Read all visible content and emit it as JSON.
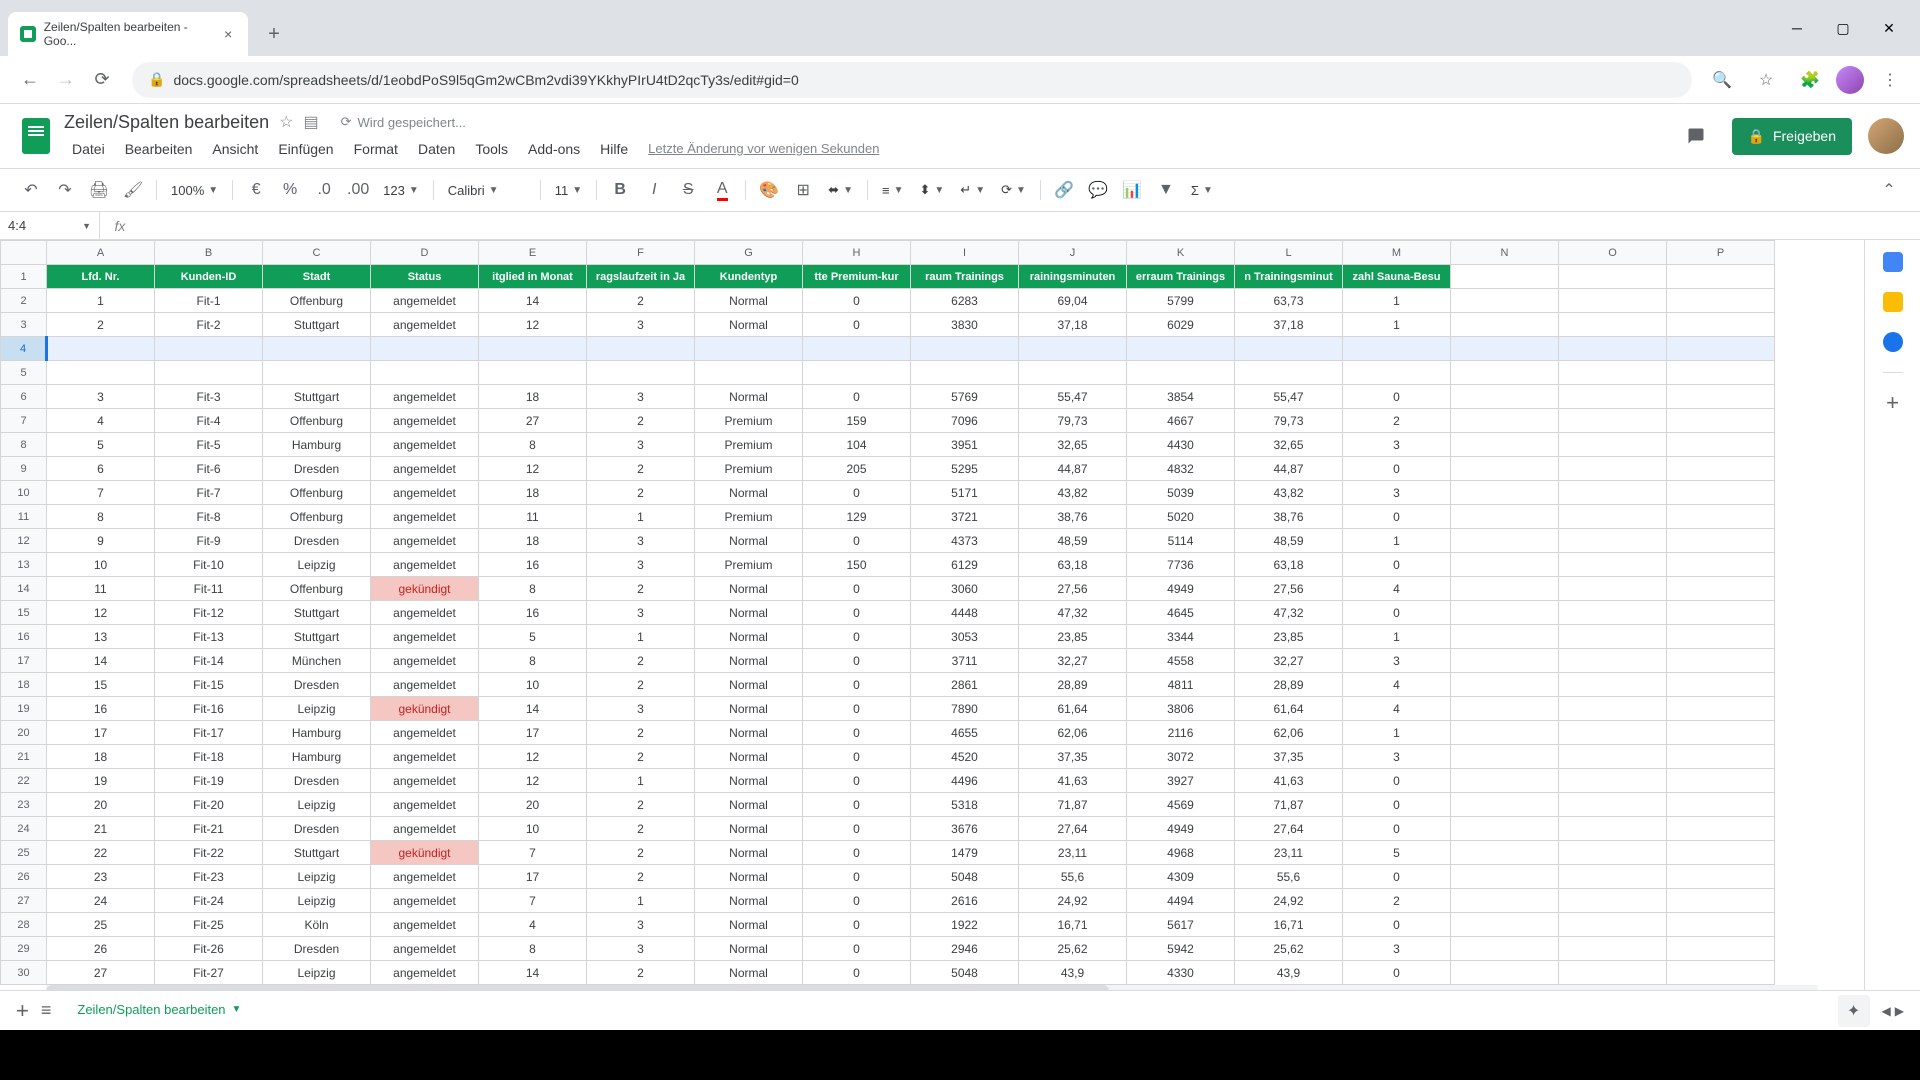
{
  "browser": {
    "tab_title": "Zeilen/Spalten bearbeiten - Goo...",
    "url": "docs.google.com/spreadsheets/d/1eobdPoS9l5qGm2wCBm2vdi39YKkhyPIrU4tD2qcTy3s/edit#gid=0"
  },
  "doc": {
    "title": "Zeilen/Spalten bearbeiten",
    "saving": "Wird gespeichert...",
    "last_edit": "Letzte Änderung vor wenigen Sekunden",
    "share": "Freigeben"
  },
  "menus": [
    "Datei",
    "Bearbeiten",
    "Ansicht",
    "Einfügen",
    "Format",
    "Daten",
    "Tools",
    "Add-ons",
    "Hilfe"
  ],
  "toolbar": {
    "zoom": "100%",
    "num_fmt": "123",
    "font": "Calibri",
    "font_size": "11"
  },
  "name_box": "4:4",
  "columns": [
    "A",
    "B",
    "C",
    "D",
    "E",
    "F",
    "G",
    "H",
    "I",
    "J",
    "K",
    "L",
    "M",
    "N",
    "O",
    "P"
  ],
  "headers": [
    "Lfd. Nr.",
    "Kunden-ID",
    "Stadt",
    "Status",
    "itglied in Monat",
    "ragslaufzeit in Ja",
    "Kundentyp",
    "tte Premium-kur",
    "raum Trainings",
    "rainingsminuten",
    "erraum Trainings",
    "n Trainingsminut",
    "zahl Sauna-Besu"
  ],
  "sheet_name": "Zeilen/Spalten bearbeiten",
  "selected_row": 4,
  "rows": [
    {
      "r": 2,
      "d": [
        "1",
        "Fit-1",
        "Offenburg",
        "angemeldet",
        "14",
        "2",
        "Normal",
        "0",
        "6283",
        "69,04",
        "5799",
        "63,73",
        "1"
      ]
    },
    {
      "r": 3,
      "d": [
        "2",
        "Fit-2",
        "Stuttgart",
        "angemeldet",
        "12",
        "3",
        "Normal",
        "0",
        "3830",
        "37,18",
        "6029",
        "37,18",
        "1"
      ]
    },
    {
      "r": 4,
      "d": [
        "",
        "",
        "",
        "",
        "",
        "",
        "",
        "",
        "",
        "",
        "",
        "",
        ""
      ],
      "sel": true
    },
    {
      "r": 5,
      "d": [
        "",
        "",
        "",
        "",
        "",
        "",
        "",
        "",
        "",
        "",
        "",
        "",
        ""
      ],
      "blank": true
    },
    {
      "r": 6,
      "d": [
        "3",
        "Fit-3",
        "Stuttgart",
        "angemeldet",
        "18",
        "3",
        "Normal",
        "0",
        "5769",
        "55,47",
        "3854",
        "55,47",
        "0"
      ]
    },
    {
      "r": 7,
      "d": [
        "4",
        "Fit-4",
        "Offenburg",
        "angemeldet",
        "27",
        "2",
        "Premium",
        "159",
        "7096",
        "79,73",
        "4667",
        "79,73",
        "2"
      ]
    },
    {
      "r": 8,
      "d": [
        "5",
        "Fit-5",
        "Hamburg",
        "angemeldet",
        "8",
        "3",
        "Premium",
        "104",
        "3951",
        "32,65",
        "4430",
        "32,65",
        "3"
      ]
    },
    {
      "r": 9,
      "d": [
        "6",
        "Fit-6",
        "Dresden",
        "angemeldet",
        "12",
        "2",
        "Premium",
        "205",
        "5295",
        "44,87",
        "4832",
        "44,87",
        "0"
      ]
    },
    {
      "r": 10,
      "d": [
        "7",
        "Fit-7",
        "Offenburg",
        "angemeldet",
        "18",
        "2",
        "Normal",
        "0",
        "5171",
        "43,82",
        "5039",
        "43,82",
        "3"
      ]
    },
    {
      "r": 11,
      "d": [
        "8",
        "Fit-8",
        "Offenburg",
        "angemeldet",
        "11",
        "1",
        "Premium",
        "129",
        "3721",
        "38,76",
        "5020",
        "38,76",
        "0"
      ]
    },
    {
      "r": 12,
      "d": [
        "9",
        "Fit-9",
        "Dresden",
        "angemeldet",
        "18",
        "3",
        "Normal",
        "0",
        "4373",
        "48,59",
        "5114",
        "48,59",
        "1"
      ]
    },
    {
      "r": 13,
      "d": [
        "10",
        "Fit-10",
        "Leipzig",
        "angemeldet",
        "16",
        "3",
        "Premium",
        "150",
        "6129",
        "63,18",
        "7736",
        "63,18",
        "0"
      ]
    },
    {
      "r": 14,
      "d": [
        "11",
        "Fit-11",
        "Offenburg",
        "gekündigt",
        "8",
        "2",
        "Normal",
        "0",
        "3060",
        "27,56",
        "4949",
        "27,56",
        "4"
      ],
      "cancel": true
    },
    {
      "r": 15,
      "d": [
        "12",
        "Fit-12",
        "Stuttgart",
        "angemeldet",
        "16",
        "3",
        "Normal",
        "0",
        "4448",
        "47,32",
        "4645",
        "47,32",
        "0"
      ]
    },
    {
      "r": 16,
      "d": [
        "13",
        "Fit-13",
        "Stuttgart",
        "angemeldet",
        "5",
        "1",
        "Normal",
        "0",
        "3053",
        "23,85",
        "3344",
        "23,85",
        "1"
      ]
    },
    {
      "r": 17,
      "d": [
        "14",
        "Fit-14",
        "München",
        "angemeldet",
        "8",
        "2",
        "Normal",
        "0",
        "3711",
        "32,27",
        "4558",
        "32,27",
        "3"
      ]
    },
    {
      "r": 18,
      "d": [
        "15",
        "Fit-15",
        "Dresden",
        "angemeldet",
        "10",
        "2",
        "Normal",
        "0",
        "2861",
        "28,89",
        "4811",
        "28,89",
        "4"
      ]
    },
    {
      "r": 19,
      "d": [
        "16",
        "Fit-16",
        "Leipzig",
        "gekündigt",
        "14",
        "3",
        "Normal",
        "0",
        "7890",
        "61,64",
        "3806",
        "61,64",
        "4"
      ],
      "cancel": true
    },
    {
      "r": 20,
      "d": [
        "17",
        "Fit-17",
        "Hamburg",
        "angemeldet",
        "17",
        "2",
        "Normal",
        "0",
        "4655",
        "62,06",
        "2116",
        "62,06",
        "1"
      ]
    },
    {
      "r": 21,
      "d": [
        "18",
        "Fit-18",
        "Hamburg",
        "angemeldet",
        "12",
        "2",
        "Normal",
        "0",
        "4520",
        "37,35",
        "3072",
        "37,35",
        "3"
      ]
    },
    {
      "r": 22,
      "d": [
        "19",
        "Fit-19",
        "Dresden",
        "angemeldet",
        "12",
        "1",
        "Normal",
        "0",
        "4496",
        "41,63",
        "3927",
        "41,63",
        "0"
      ]
    },
    {
      "r": 23,
      "d": [
        "20",
        "Fit-20",
        "Leipzig",
        "angemeldet",
        "20",
        "2",
        "Normal",
        "0",
        "5318",
        "71,87",
        "4569",
        "71,87",
        "0"
      ]
    },
    {
      "r": 24,
      "d": [
        "21",
        "Fit-21",
        "Dresden",
        "angemeldet",
        "10",
        "2",
        "Normal",
        "0",
        "3676",
        "27,64",
        "4949",
        "27,64",
        "0"
      ]
    },
    {
      "r": 25,
      "d": [
        "22",
        "Fit-22",
        "Stuttgart",
        "gekündigt",
        "7",
        "2",
        "Normal",
        "0",
        "1479",
        "23,11",
        "4968",
        "23,11",
        "5"
      ],
      "cancel": true
    },
    {
      "r": 26,
      "d": [
        "23",
        "Fit-23",
        "Leipzig",
        "angemeldet",
        "17",
        "2",
        "Normal",
        "0",
        "5048",
        "55,6",
        "4309",
        "55,6",
        "0"
      ]
    },
    {
      "r": 27,
      "d": [
        "24",
        "Fit-24",
        "Leipzig",
        "angemeldet",
        "7",
        "1",
        "Normal",
        "0",
        "2616",
        "24,92",
        "4494",
        "24,92",
        "2"
      ]
    },
    {
      "r": 28,
      "d": [
        "25",
        "Fit-25",
        "Köln",
        "angemeldet",
        "4",
        "3",
        "Normal",
        "0",
        "1922",
        "16,71",
        "5617",
        "16,71",
        "0"
      ]
    },
    {
      "r": 29,
      "d": [
        "26",
        "Fit-26",
        "Dresden",
        "angemeldet",
        "8",
        "3",
        "Normal",
        "0",
        "2946",
        "25,62",
        "5942",
        "25,62",
        "3"
      ]
    },
    {
      "r": 30,
      "d": [
        "27",
        "Fit-27",
        "Leipzig",
        "angemeldet",
        "14",
        "2",
        "Normal",
        "0",
        "5048",
        "43,9",
        "4330",
        "43,9",
        "0"
      ]
    }
  ]
}
